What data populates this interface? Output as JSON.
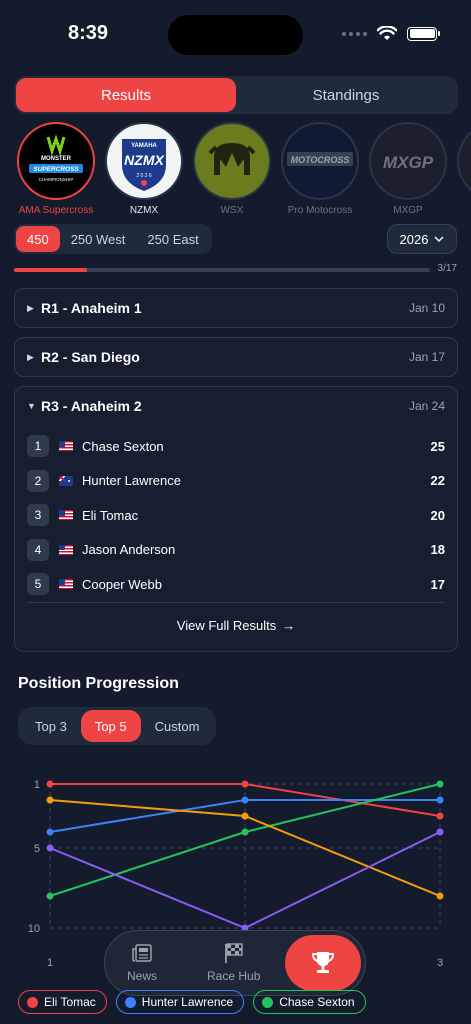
{
  "status": {
    "time": "8:39"
  },
  "tabs": {
    "results": "Results",
    "standings": "Standings"
  },
  "series": [
    {
      "name": "AMA Supercross",
      "logo_text": "MONSTER SUPERCROSS"
    },
    {
      "name": "NZMX",
      "logo_text": "NZMX"
    },
    {
      "name": "WSX",
      "logo_text": ""
    },
    {
      "name": "Pro Motocross",
      "logo_text": "MOTOCROSS"
    },
    {
      "name": "MXGP",
      "logo_text": "MXGP"
    }
  ],
  "classes": [
    "450",
    "250 West",
    "250 East"
  ],
  "year": "2026",
  "progress": {
    "text": "3/17",
    "completed": 3,
    "total": 17
  },
  "rounds": [
    {
      "title": "R1 - Anaheim 1",
      "date": "Jan 10",
      "arrow": "▶"
    },
    {
      "title": "R2 - San Diego",
      "date": "Jan 17",
      "arrow": "▶"
    },
    {
      "title": "R3 - Anaheim 2",
      "date": "Jan 24",
      "arrow": "▼",
      "results": [
        {
          "pos": "1",
          "name": "Chase Sexton",
          "points": "25",
          "flag": "us"
        },
        {
          "pos": "2",
          "name": "Hunter Lawrence",
          "points": "22",
          "flag": "au"
        },
        {
          "pos": "3",
          "name": "Eli Tomac",
          "points": "20",
          "flag": "us"
        },
        {
          "pos": "4",
          "name": "Jason Anderson",
          "points": "18",
          "flag": "us"
        },
        {
          "pos": "5",
          "name": "Cooper Webb",
          "points": "17",
          "flag": "us"
        }
      ],
      "view_full": "View Full Results",
      "view_full_arrow": "→"
    }
  ],
  "progression": {
    "title": "Position Progression",
    "modes": [
      "Top 3",
      "Top 5",
      "Custom"
    ]
  },
  "nav": {
    "news": "News",
    "race_hub": "Race Hub"
  },
  "colors": {
    "accent": "#ef4444",
    "bg": "#141b2d"
  },
  "chart_data": {
    "type": "line",
    "x": [
      1,
      2,
      3
    ],
    "x_tick_labels": [
      "1",
      "3"
    ],
    "y_tick_labels": [
      "1",
      "5",
      "10"
    ],
    "ylim": [
      1,
      10
    ],
    "y_inverted": true,
    "grid": true,
    "series": [
      {
        "name": "Eli Tomac",
        "color": "#ef4444",
        "values": [
          1,
          1,
          3
        ]
      },
      {
        "name": "Hunter Lawrence",
        "color": "#3b82f6",
        "values": [
          4,
          2,
          2
        ]
      },
      {
        "name": "Chase Sexton",
        "color": "#22c55e",
        "values": [
          8,
          4,
          1
        ]
      },
      {
        "name": "",
        "color": "#f59e0b",
        "values": [
          2,
          3,
          8
        ]
      },
      {
        "name": "",
        "color": "#8b5cf6",
        "values": [
          5,
          10,
          4
        ]
      }
    ]
  }
}
